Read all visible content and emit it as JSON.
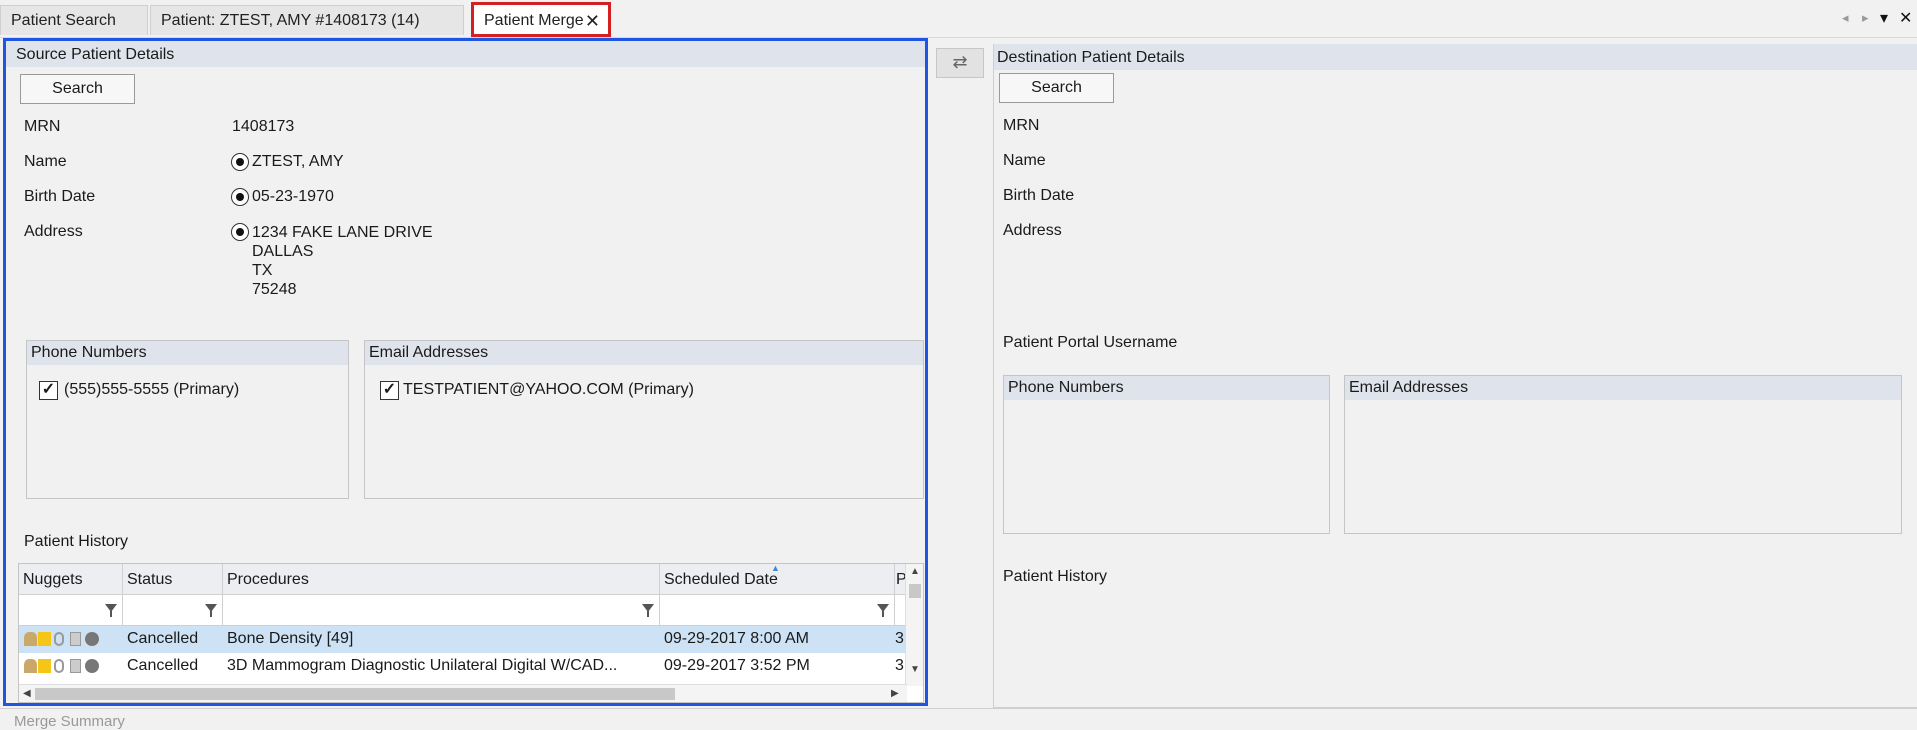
{
  "tabs": [
    {
      "label": "Patient Search"
    },
    {
      "label": "Patient: ZTEST, AMY #1408173 (14)"
    },
    {
      "label": "Patient Merge",
      "close": "✕"
    }
  ],
  "tab_controls": {
    "prev": "◂",
    "next": "▸",
    "menu": "▾",
    "close": "✕"
  },
  "source": {
    "header": "Source Patient Details",
    "search_label": "Search",
    "fields": {
      "mrn_label": "MRN",
      "mrn_value": "1408173",
      "name_label": "Name",
      "name_value": "ZTEST, AMY",
      "birth_label": "Birth Date",
      "birth_value": "05-23-1970",
      "address_label": "Address",
      "address_line1": "1234  FAKE  LANE  DRIVE",
      "address_line2": "DALLAS",
      "address_line3": "TX",
      "address_line4": "75248"
    },
    "phone_header": "Phone Numbers",
    "phone_item": "(555)555-5555  (Primary)",
    "email_header": "Email Addresses",
    "email_item": "TESTPATIENT@YAHOO.COM   (Primary)",
    "history_label": "Patient History",
    "grid": {
      "columns": [
        "Nuggets",
        "Status",
        "Procedures",
        "Scheduled Date",
        "P"
      ],
      "rows": [
        {
          "status": "Cancelled",
          "procedure": "Bone Density [49]",
          "date": "09-29-2017 8:00 AM",
          "extra": "3"
        },
        {
          "status": "Cancelled",
          "procedure": "3D Mammogram Diagnostic Unilateral Digital W/CAD...",
          "date": "09-29-2017 3:52 PM",
          "extra": "3"
        }
      ]
    }
  },
  "swap_icon": "⇄",
  "destination": {
    "header": "Destination Patient Details",
    "search_label": "Search",
    "mrn_label": "MRN",
    "name_label": "Name",
    "birth_label": "Birth Date",
    "address_label": "Address",
    "portal_label": "Patient Portal Username",
    "phone_header": "Phone Numbers",
    "email_header": "Email Addresses",
    "history_label": "Patient History"
  },
  "merge_summary": "Merge Summary",
  "colors": {
    "selection_border": "#1f55e0",
    "active_tab_border": "#d42020",
    "selected_row": "#cde2f4"
  }
}
